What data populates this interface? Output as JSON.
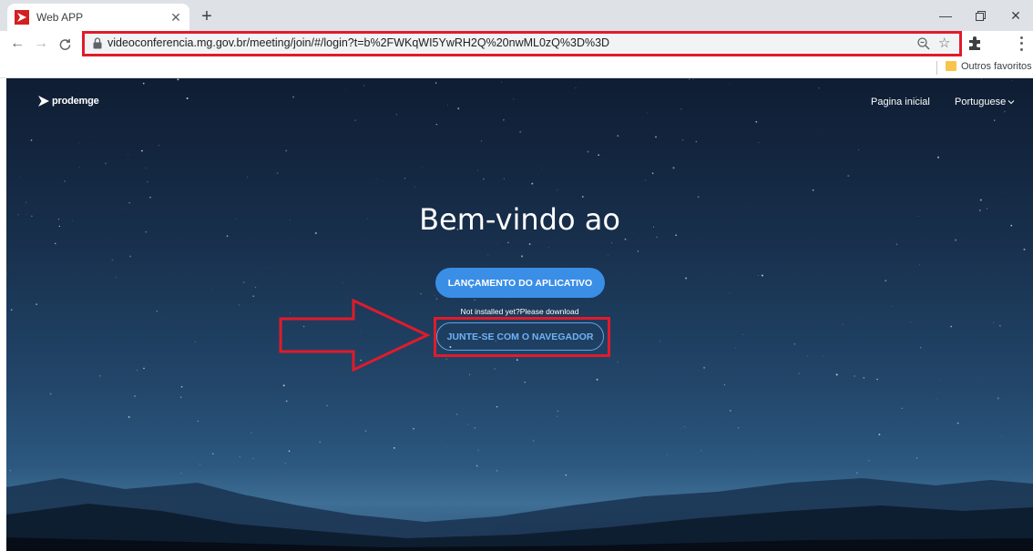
{
  "browser": {
    "tab_title": "Web APP",
    "url": "videoconferencia.mg.gov.br/meeting/join/#/login?t=b%2FWKqWI5YwRH2Q%20nwML0zQ%3D%3D",
    "bookmark_folder": "Outros favoritos",
    "accent_highlight": "#e01b2b"
  },
  "page": {
    "logo_text": "prodemge",
    "nav_home": "Pagina inicial",
    "nav_language": "Portuguese",
    "welcome_title": "Bem-vindo ao",
    "launch_button": "LANÇAMENTO DO APLICATIVO",
    "not_installed_text": "Not installed yet?Please download",
    "browser_button": "JUNTE-SE COM O NAVEGADOR",
    "button_color": "#3a8ee6"
  }
}
